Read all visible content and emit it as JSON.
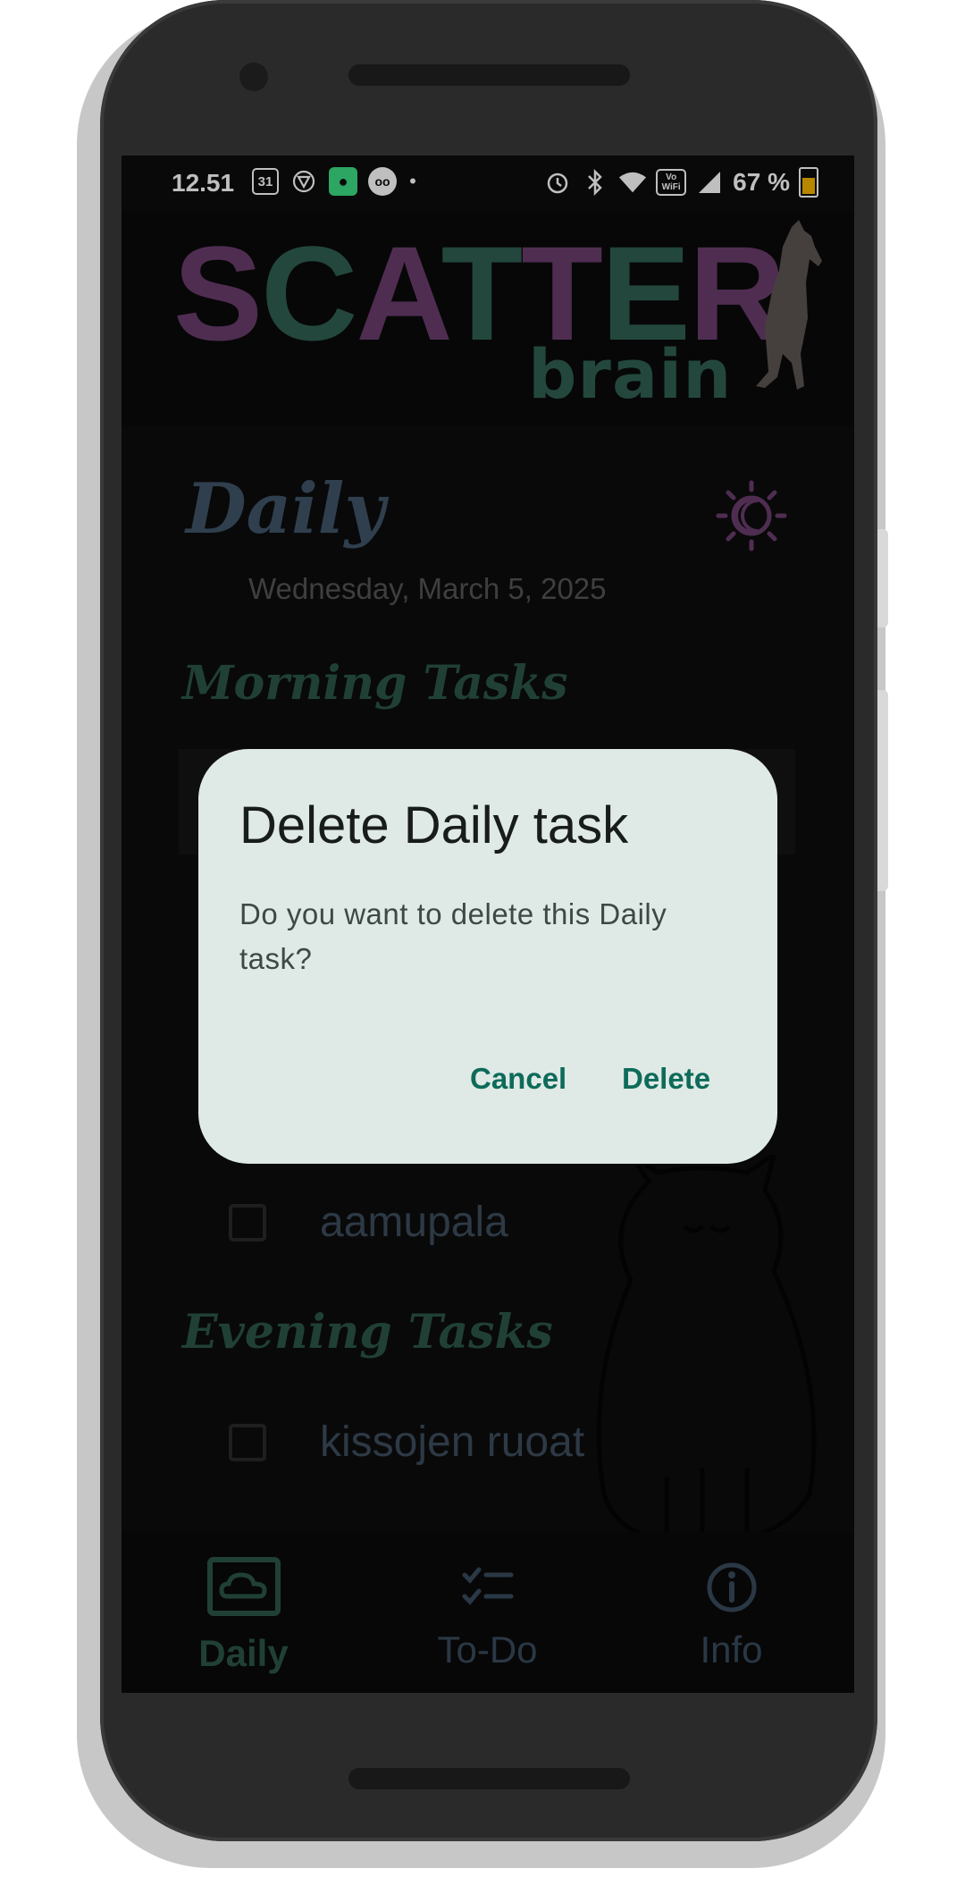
{
  "status_bar": {
    "time": "12.51",
    "calendar_day": "31",
    "battery_percent": "67 %",
    "left_icons": [
      "calendar-icon",
      "openai-icon",
      "chat-icon",
      "voicemail-icon",
      "dot-icon"
    ],
    "right_icons": [
      "alarm-icon",
      "bluetooth-icon",
      "wifi-icon",
      "vowifi-icon",
      "signal-icon",
      "battery-icon"
    ],
    "vowifi_label": "Vo WiFi"
  },
  "header": {
    "logo_letters": [
      "S",
      "C",
      "A",
      "T",
      "T",
      "E",
      "R"
    ],
    "logo_sub": "brain"
  },
  "page": {
    "title": "Daily",
    "date": "Wednesday, March 5, 2025"
  },
  "sections": {
    "morning": "Morning Tasks",
    "evening": "Evening Tasks"
  },
  "tasks": {
    "morning_visible": "aamupala",
    "evening_visible": "kissojen ruoat"
  },
  "bottom_nav": {
    "items": [
      {
        "label": "Daily",
        "icon": "cloud-icon",
        "active": true
      },
      {
        "label": "To-Do",
        "icon": "checklist-icon",
        "active": false
      },
      {
        "label": "Info",
        "icon": "info-icon",
        "active": false
      }
    ]
  },
  "dialog": {
    "title": "Delete Daily task",
    "message": "Do you want to delete this Daily task?",
    "cancel_label": "Cancel",
    "delete_label": "Delete"
  },
  "colors": {
    "accent_green": "#2b5649",
    "accent_purple": "#6a3c6c",
    "dialog_bg": "#dfe9e5",
    "dialog_button": "#0d6b5a"
  }
}
